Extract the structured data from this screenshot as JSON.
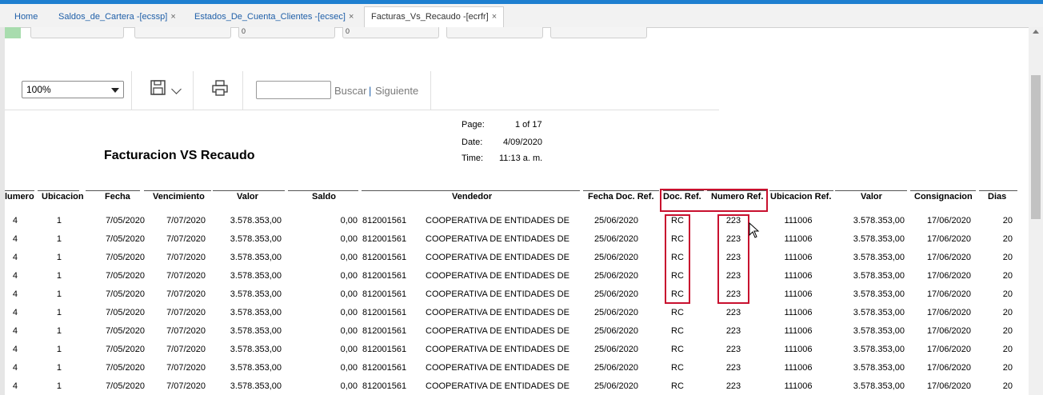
{
  "tabs": [
    {
      "label": "Home",
      "close": ""
    },
    {
      "label": "Saldos_de_Cartera -[ecssp]",
      "close": "×"
    },
    {
      "label": "Estados_De_Cuenta_Clientes -[ecsec]",
      "close": "×"
    },
    {
      "label": "Facturas_Vs_Recaudo -[ecrfr]",
      "close": "×"
    }
  ],
  "params": [
    "0",
    "0"
  ],
  "toolbar": {
    "zoom_value": "100%",
    "search_placeholder": "",
    "find_label": "Buscar",
    "find_separator": "|",
    "next_label": "Siguiente",
    "save_icon": "floppy-disk-icon",
    "print_icon": "printer-icon"
  },
  "report": {
    "title": "Facturacion VS Recaudo",
    "page_label": "Page:",
    "page_value": "1 of 17",
    "date_label": "Date:",
    "date_value": "4/09/2020",
    "time_label": "Time:",
    "time_value": "11:13 a. m."
  },
  "table": {
    "columns": [
      "lumero",
      "Ubicacion",
      "Fecha",
      "Vencimiento",
      "Valor",
      "Saldo",
      "Vendedor",
      "Fecha Doc. Ref.",
      "Doc. Ref.",
      "Numero Ref.",
      "Ubicacion Ref.",
      "Valor",
      "Consignacion",
      "Dias"
    ],
    "rows": [
      [
        "4",
        "1",
        "7/05/2020",
        "7/07/2020",
        "3.578.353,00",
        "0,00",
        "812001561",
        "COOPERATIVA DE ENTIDADES DE",
        "25/06/2020",
        "RC",
        "223",
        "111006",
        "3.578.353,00",
        "17/06/2020",
        "20"
      ],
      [
        "4",
        "1",
        "7/05/2020",
        "7/07/2020",
        "3.578.353,00",
        "0,00",
        "812001561",
        "COOPERATIVA DE ENTIDADES DE",
        "25/06/2020",
        "RC",
        "223",
        "111006",
        "3.578.353,00",
        "17/06/2020",
        "20"
      ],
      [
        "4",
        "1",
        "7/05/2020",
        "7/07/2020",
        "3.578.353,00",
        "0,00",
        "812001561",
        "COOPERATIVA DE ENTIDADES DE",
        "25/06/2020",
        "RC",
        "223",
        "111006",
        "3.578.353,00",
        "17/06/2020",
        "20"
      ],
      [
        "4",
        "1",
        "7/05/2020",
        "7/07/2020",
        "3.578.353,00",
        "0,00",
        "812001561",
        "COOPERATIVA DE ENTIDADES DE",
        "25/06/2020",
        "RC",
        "223",
        "111006",
        "3.578.353,00",
        "17/06/2020",
        "20"
      ],
      [
        "4",
        "1",
        "7/05/2020",
        "7/07/2020",
        "3.578.353,00",
        "0,00",
        "812001561",
        "COOPERATIVA DE ENTIDADES DE",
        "25/06/2020",
        "RC",
        "223",
        "111006",
        "3.578.353,00",
        "17/06/2020",
        "20"
      ],
      [
        "4",
        "1",
        "7/05/2020",
        "7/07/2020",
        "3.578.353,00",
        "0,00",
        "812001561",
        "COOPERATIVA DE ENTIDADES DE",
        "25/06/2020",
        "RC",
        "223",
        "111006",
        "3.578.353,00",
        "17/06/2020",
        "20"
      ],
      [
        "4",
        "1",
        "7/05/2020",
        "7/07/2020",
        "3.578.353,00",
        "0,00",
        "812001561",
        "COOPERATIVA DE ENTIDADES DE",
        "25/06/2020",
        "RC",
        "223",
        "111006",
        "3.578.353,00",
        "17/06/2020",
        "20"
      ],
      [
        "4",
        "1",
        "7/05/2020",
        "7/07/2020",
        "3.578.353,00",
        "0,00",
        "812001561",
        "COOPERATIVA DE ENTIDADES DE",
        "25/06/2020",
        "RC",
        "223",
        "111006",
        "3.578.353,00",
        "17/06/2020",
        "20"
      ],
      [
        "4",
        "1",
        "7/05/2020",
        "7/07/2020",
        "3.578.353,00",
        "0,00",
        "812001561",
        "COOPERATIVA DE ENTIDADES DE",
        "25/06/2020",
        "RC",
        "223",
        "111006",
        "3.578.353,00",
        "17/06/2020",
        "20"
      ],
      [
        "4",
        "1",
        "7/05/2020",
        "7/07/2020",
        "3.578.353,00",
        "0,00",
        "812001561",
        "COOPERATIVA DE ENTIDADES DE",
        "25/06/2020",
        "RC",
        "223",
        "111006",
        "3.578.353,00",
        "17/06/2020",
        "20"
      ]
    ]
  },
  "colors": {
    "accent": "#1e7fd0",
    "highlight": "#c8102e",
    "tab_text": "#1f5fa8"
  }
}
